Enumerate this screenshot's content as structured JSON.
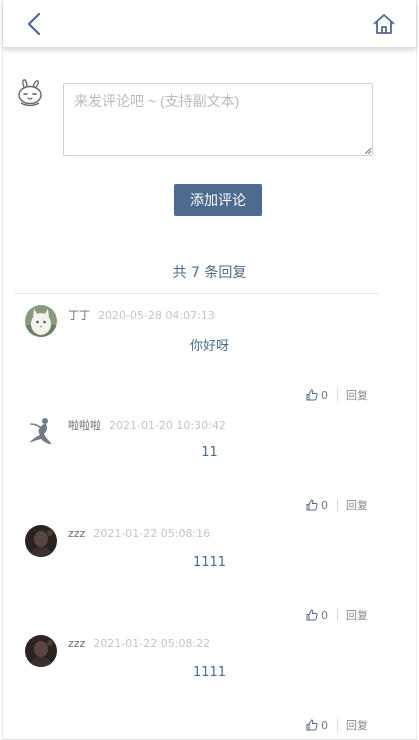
{
  "header": {
    "back_icon": "chevron-left-icon",
    "home_icon": "home-icon"
  },
  "composer": {
    "avatar_icon": "rabbit-avatar-icon",
    "placeholder": "来发评论吧 ~ (支持副文本)",
    "value": "",
    "submit_label": "添加评论"
  },
  "summary": {
    "count_text": "共 7 条回复"
  },
  "comments": [
    {
      "nick": "丁丁",
      "time": "2020-05-28 04:07:13",
      "content": "你好呀",
      "likes": "0",
      "reply_label": "回复",
      "avatar": "white-cat-avatar"
    },
    {
      "nick": "啦啦啦",
      "time": "2021-01-20 10:30:42",
      "content": "11",
      "likes": "0",
      "reply_label": "回复",
      "avatar": "dancer-silhouette-avatar"
    },
    {
      "nick": "zzz",
      "time": "2021-01-22 05:08:16",
      "content": "1111",
      "likes": "0",
      "reply_label": "回复",
      "avatar": "dark-photo-avatar"
    },
    {
      "nick": "zzz",
      "time": "2021-01-22 05:08:22",
      "content": "1111",
      "likes": "0",
      "reply_label": "回复",
      "avatar": "dark-photo-avatar"
    }
  ],
  "colors": {
    "accent": "#4d6a8f",
    "meta_text": "#c4c4c4"
  }
}
